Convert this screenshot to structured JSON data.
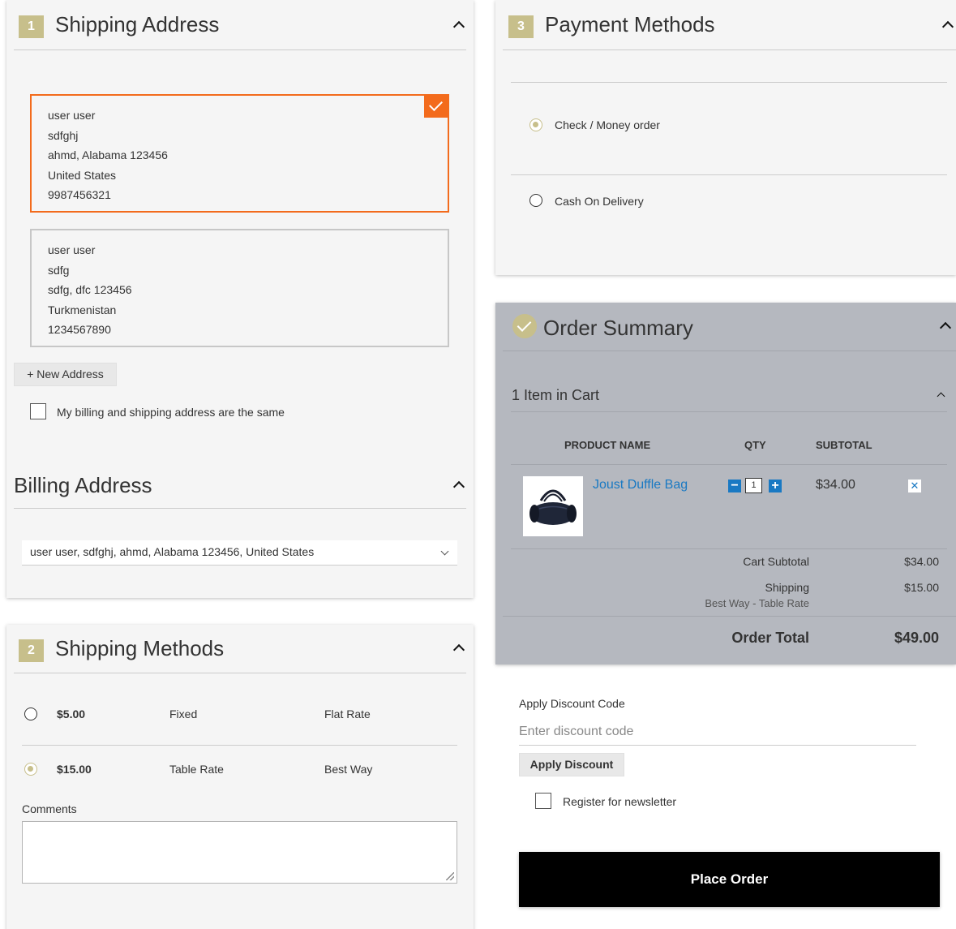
{
  "shipping_address": {
    "step_number": "1",
    "title": "Shipping Address",
    "addresses": [
      {
        "name": "user user",
        "street": "sdfghj",
        "city_line": "ahmd, Alabama 123456",
        "country": "United States",
        "phone": "9987456321",
        "selected": true
      },
      {
        "name": "user user",
        "street": "sdfg",
        "city_line": "sdfg, dfc 123456",
        "country": "Turkmenistan",
        "phone": "1234567890",
        "selected": false
      }
    ],
    "new_address_label": "+ New Address",
    "same_address_label": "My billing and shipping address are the same"
  },
  "billing_address": {
    "title": "Billing Address",
    "selected_value": "user user, sdfghj, ahmd, Alabama 123456, United States"
  },
  "shipping_methods": {
    "step_number": "2",
    "title": "Shipping Methods",
    "methods": [
      {
        "price": "$5.00",
        "method": "Fixed",
        "carrier": "Flat Rate",
        "selected": false
      },
      {
        "price": "$15.00",
        "method": "Table Rate",
        "carrier": "Best Way",
        "selected": true
      }
    ],
    "comments_label": "Comments"
  },
  "payment_methods": {
    "step_number": "3",
    "title": "Payment Methods",
    "options": [
      {
        "label": "Check / Money order",
        "selected": true
      },
      {
        "label": "Cash On Delivery",
        "selected": false
      }
    ]
  },
  "order_summary": {
    "title": "Order Summary",
    "items_in_cart": "1 Item in Cart",
    "columns": {
      "product": "PRODUCT NAME",
      "qty": "QTY",
      "subtotal": "SUBTOTAL"
    },
    "item": {
      "name": "Joust Duffle Bag",
      "qty": "1",
      "subtotal": "$34.00"
    },
    "cart_subtotal_label": "Cart Subtotal",
    "cart_subtotal_value": "$34.00",
    "shipping_label": "Shipping",
    "shipping_detail": "Best Way - Table Rate",
    "shipping_value": "$15.00",
    "order_total_label": "Order Total",
    "order_total_value": "$49.00"
  },
  "discount": {
    "label": "Apply Discount Code",
    "placeholder": "Enter discount code",
    "button": "Apply Discount"
  },
  "newsletter_label": "Register for newsletter",
  "place_order_label": "Place Order",
  "colors": {
    "accent_orange": "#f36b1c",
    "step_gold": "#c7bf8b",
    "link_blue": "#1979c3",
    "summary_bg": "#b5b8bf"
  }
}
